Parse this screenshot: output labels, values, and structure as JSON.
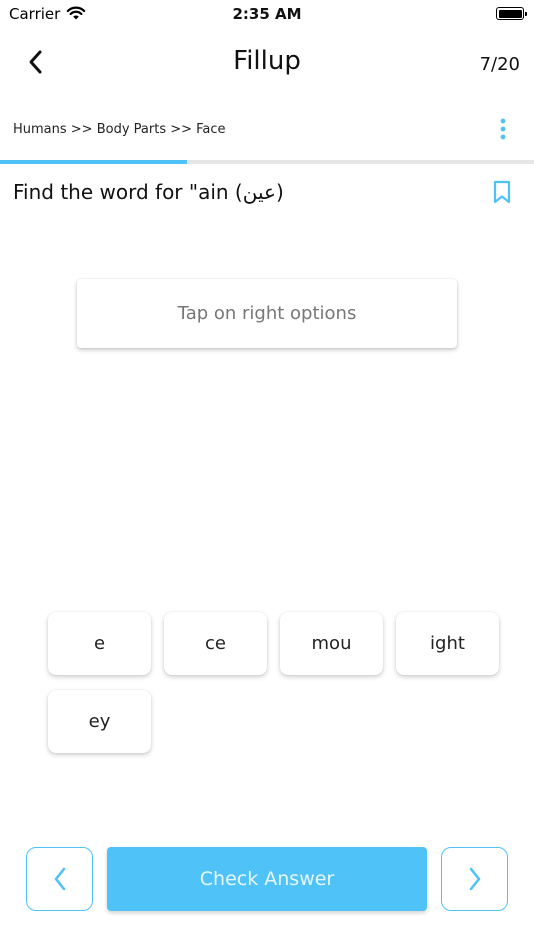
{
  "status_bar": {
    "carrier": "Carrier",
    "time": "2:35 AM"
  },
  "header": {
    "title": "Fillup",
    "counter": "7/20"
  },
  "breadcrumb": "Humans >> Body Parts >> Face",
  "progress": {
    "current": 7,
    "total": 20,
    "fraction": 0.35
  },
  "question": "Find the word for \"ain (عين)",
  "answer_placeholder": "Tap on right options",
  "options": [
    "e",
    "ce",
    "mou",
    "ight",
    "ey"
  ],
  "actions": {
    "check_answer": "Check Answer"
  },
  "colors": {
    "accent": "#4fc3f7",
    "track": "#e6e6e6"
  },
  "icons": {
    "back": "chevron-left-icon",
    "menu": "more-vertical-icon",
    "bookmark": "bookmark-icon",
    "prev": "chevron-left-icon",
    "next": "chevron-right-icon"
  }
}
